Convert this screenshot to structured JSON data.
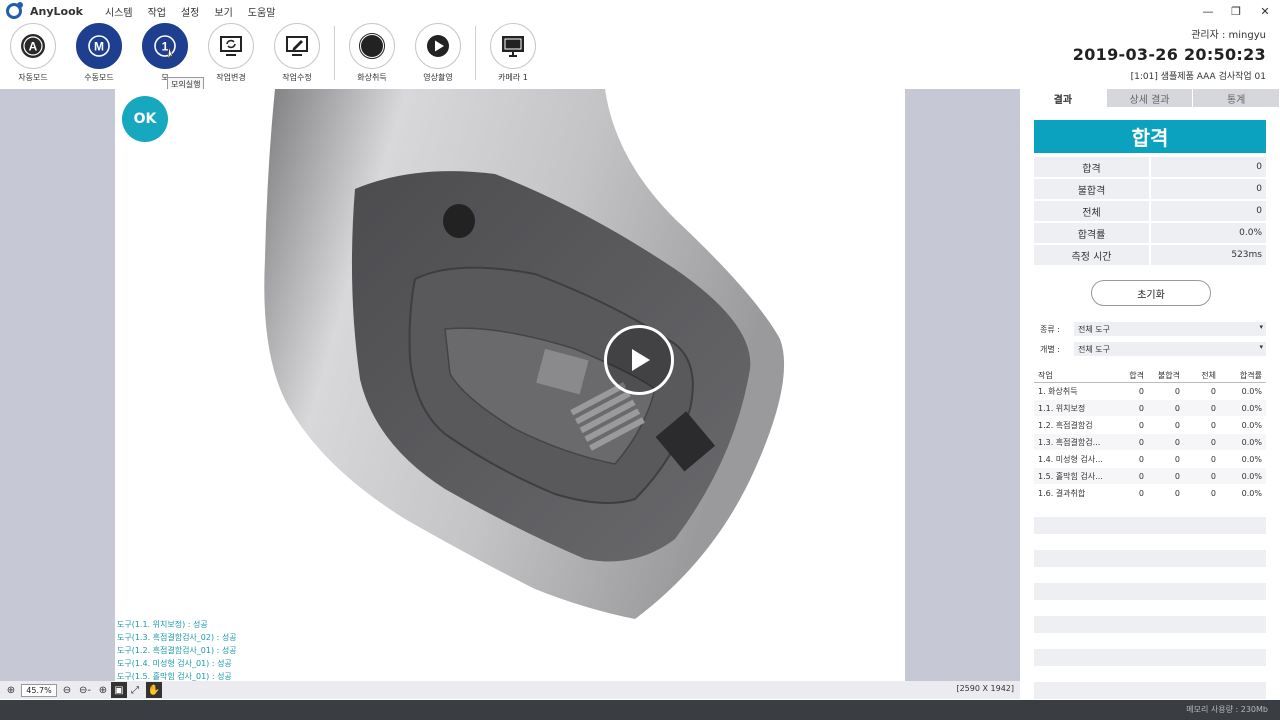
{
  "app": {
    "title": "AnyLook"
  },
  "menu": [
    "시스템",
    "작업",
    "설정",
    "보기",
    "도움말"
  ],
  "window": {
    "minimize": "—",
    "restore": "❐",
    "close": "✕"
  },
  "toolbar": {
    "auto_mode": {
      "label": "자동모드",
      "glyph": "A",
      "icon": "auto-mode-icon"
    },
    "manual_mode": {
      "label": "수동모드",
      "glyph": "M",
      "icon": "manual-mode-icon"
    },
    "sim_mode": {
      "label": "모",
      "glyph": "1",
      "icon": "simulation-run-icon"
    },
    "job_change": {
      "label": "작업변경",
      "icon": "job-change-icon"
    },
    "job_edit": {
      "label": "작업수정",
      "icon": "job-edit-icon"
    },
    "capture": {
      "label": "화상취득",
      "icon": "capture-icon"
    },
    "record": {
      "label": "영상촬영",
      "icon": "video-record-icon"
    },
    "camera": {
      "label": "카메라 1",
      "icon": "camera-monitor-icon"
    },
    "tooltip": "모의실행"
  },
  "header": {
    "user": "관리자 : mingyu",
    "datetime": "2019-03-26 20:50:23",
    "job": "[1:01] 샘플제품 AAA 검사작업 01"
  },
  "viewer": {
    "ok_badge": "OK",
    "tool_results": [
      "도구(1.1. 위치보정) : 성공",
      "도구(1.3. 흑점결함검사_02) : 성공",
      "도구(1.2. 흑점결함검사_01) : 성공",
      "도구(1.4. 미성형 검사_01) : 성공",
      "도구(1.5. 홀막힘 검사_01) : 성공"
    ],
    "image_size": "[2590 X 1942]",
    "colors": {
      "ok": "#16a8bf",
      "result_text": "#1a9aaa",
      "backdrop": "#c6c8d6"
    }
  },
  "zoombar": {
    "zoom_in": "⊕",
    "zoom_value": "45.7%",
    "zoom_out": "⊖",
    "zoom_out_alt": "⊖-",
    "zoom_fit": "⊕",
    "fit_window": "▣",
    "fullscreen": "⤢",
    "pan": "✋"
  },
  "panel": {
    "tabs": [
      "결과",
      "상세 결과",
      "통계"
    ],
    "result": "합격",
    "result_color": "#0aa2bf",
    "stats": [
      {
        "label": "합격",
        "value": "0"
      },
      {
        "label": "불합격",
        "value": "0"
      },
      {
        "label": "전체",
        "value": "0"
      },
      {
        "label": "합격률",
        "value": "0.0%"
      },
      {
        "label": "측정 시간",
        "value": "523ms"
      }
    ],
    "reset_label": "초기화",
    "filters": [
      {
        "label": "종류 :",
        "value": "전체 도구"
      },
      {
        "label": "개별 :",
        "value": "전체 도구"
      }
    ],
    "table": {
      "headers": [
        "작업",
        "합격",
        "불합격",
        "전체",
        "합격률"
      ],
      "rows": [
        [
          "1. 화상취득",
          "0",
          "0",
          "0",
          "0.0%"
        ],
        [
          "1.1. 위치보정",
          "0",
          "0",
          "0",
          "0.0%"
        ],
        [
          "1.2. 흑점결함검",
          "0",
          "0",
          "0",
          "0.0%"
        ],
        [
          "1.3. 흑점결함검...",
          "0",
          "0",
          "0",
          "0.0%"
        ],
        [
          "1.4. 미성형 검사...",
          "0",
          "0",
          "0",
          "0.0%"
        ],
        [
          "1.5. 홀막힘 검사...",
          "0",
          "0",
          "0",
          "0.0%"
        ],
        [
          "1.6. 결과취합",
          "0",
          "0",
          "0",
          "0.0%"
        ]
      ]
    }
  },
  "status": {
    "memory": "메모리 사용량 : 230Mb"
  }
}
